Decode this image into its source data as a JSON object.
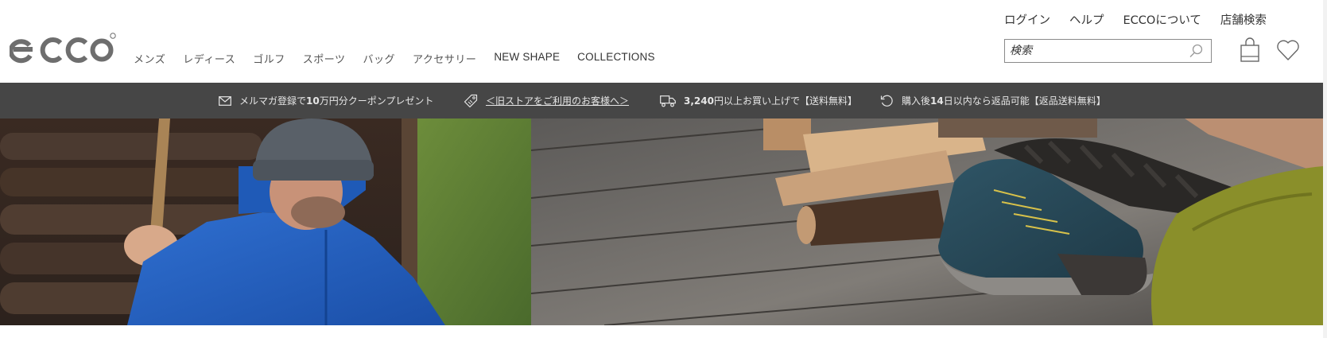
{
  "brand": {
    "logo_text": "ecco",
    "registered_mark": "®"
  },
  "main_nav": {
    "items": [
      {
        "label": "メンズ"
      },
      {
        "label": "レディース"
      },
      {
        "label": "ゴルフ"
      },
      {
        "label": "スポーツ"
      },
      {
        "label": "バッグ"
      },
      {
        "label": "アクセサリー"
      },
      {
        "label": "NEW SHAPE"
      },
      {
        "label": "COLLECTIONS"
      }
    ]
  },
  "utility_nav": {
    "items": [
      {
        "label": "ログイン"
      },
      {
        "label": "ヘルプ"
      },
      {
        "label": "ECCOについて"
      },
      {
        "label": "店舗検索"
      }
    ]
  },
  "search": {
    "placeholder": "検索",
    "value": "",
    "icon": "search-icon"
  },
  "header_icons": {
    "bag": "shopping-bag-icon",
    "wishlist": "heart-icon"
  },
  "promo_bar": {
    "items": [
      {
        "icon": "envelope-icon",
        "pre": "メルマガ登録で",
        "bold": "10",
        "post": "万円分クーポンプレゼント"
      },
      {
        "icon": "tag-icon",
        "link": "＜旧ストアをご利用のお客様へ＞"
      },
      {
        "icon": "truck-icon",
        "bold": "3,240",
        "post": "円以上お買い上げで【送料無料】"
      },
      {
        "icon": "return-icon",
        "pre": "購入後",
        "bold": "14",
        "post": "日以内なら返品可能【返品送料無料】"
      }
    ]
  },
  "colors": {
    "promo_background": "#464646",
    "promo_text": "#e6e6e6",
    "text_dark": "#333333",
    "logo_gray": "#6e6e6e"
  },
  "hero": {
    "left_image": "man-in-blue-down-jacket-photo",
    "right_image": "blue-suede-hiking-shoes-on-wooden-deck-photo"
  }
}
